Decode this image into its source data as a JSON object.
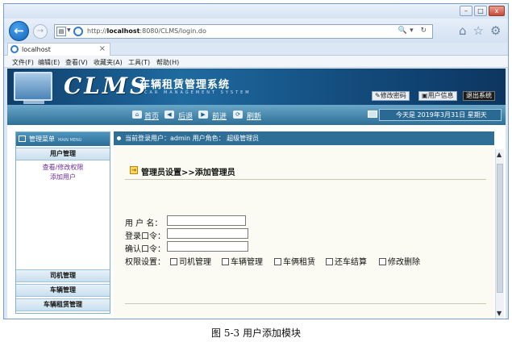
{
  "browser": {
    "window_controls": [
      "–",
      "□",
      "x"
    ],
    "url_prefix": "http://",
    "url_host": "localhost",
    "url_rest": ":8080/CLMS/login.do",
    "tab_title": "localhost",
    "tab_close": "×",
    "menu": [
      "文件(F)",
      "编辑(E)",
      "查看(V)",
      "收藏夹(A)",
      "工具(T)",
      "帮助(H)"
    ]
  },
  "header": {
    "logo": "CLMS",
    "title": "车辆租赁管理系统",
    "subtitle": "CAR MANAGEMENT SYSTEM",
    "change_password": "修改密码",
    "user_info": "用户信息",
    "logout": "退出系统"
  },
  "toolbar": {
    "home": "首页",
    "back": "后退",
    "forward": "前进",
    "refresh": "刷新",
    "date_text": "今天是 2019年3月31日 星期天"
  },
  "sidebar": {
    "title": "管理菜单",
    "title_en": "MAIN MENU",
    "groups": [
      "用户管理",
      "司机管理",
      "车辆管理",
      "车辆租赁管理"
    ],
    "user_links": [
      "查看/修改权限",
      "添加用户"
    ]
  },
  "main": {
    "current_user_text": "当前登录用户：admin  用户角色：  超级管理员",
    "page_title": "管理员设置>>添加管理员",
    "form": {
      "username_label": "用 户 名：",
      "password_label": "登录口令：",
      "confirm_label": "确认口令：",
      "permission_label": "权限设置：",
      "permissions": [
        "司机管理",
        "车辆管理",
        "车俩租赁",
        "还车结算",
        "修改删除"
      ]
    }
  },
  "caption": "图 5-3  用户添加模块"
}
